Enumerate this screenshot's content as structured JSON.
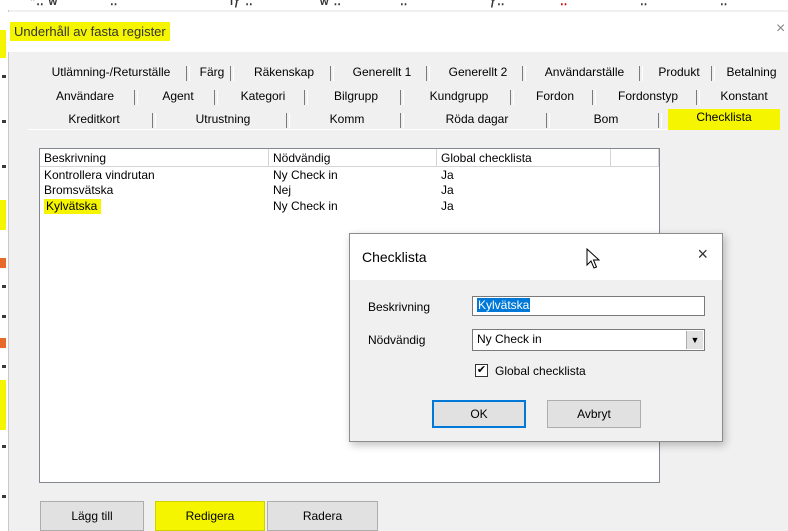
{
  "window": {
    "title": "Underhåll av fasta register",
    "close_glyph": "×"
  },
  "tabs": {
    "row1": [
      "Utlämning-/Returställe",
      "Färg",
      "Räkenskap",
      "Generellt 1",
      "Generellt 2",
      "Användarställe",
      "Produkt",
      "Betalning"
    ],
    "row2": [
      "Användare",
      "Agent",
      "Kategori",
      "Bilgrupp",
      "Kundgrupp",
      "Fordon",
      "Fordonstyp",
      "Konstant"
    ],
    "row3": [
      "Kreditkort",
      "Utrustning",
      "Komm",
      "Röda dagar",
      "Bom",
      "Checklista"
    ],
    "active": "Checklista"
  },
  "list": {
    "columns": [
      "Beskrivning",
      "Nödvändig",
      "Global checklista"
    ],
    "rows": [
      [
        "Kontrollera vindrutan",
        "Ny Check in",
        "Ja"
      ],
      [
        "Bromsvätska",
        "Nej",
        "Ja"
      ],
      [
        "Kylvätska",
        "Ny Check in",
        "Ja"
      ]
    ],
    "highlighted_row": 2
  },
  "buttons": {
    "add": "Lägg till",
    "edit": "Redigera",
    "delete": "Radera"
  },
  "dialog": {
    "title": "Checklista",
    "close_glyph": "×",
    "description_label": "Beskrivning",
    "description_value": "Kylvätska",
    "required_label": "Nödvändig",
    "required_value": "Ny Check in",
    "global_label": "Global checklista",
    "global_checked": true,
    "check_glyph": "✔",
    "ok": "OK",
    "cancel": "Avbryt"
  },
  "colors": {
    "highlight": "#f5f500",
    "selection": "#0078d7"
  }
}
